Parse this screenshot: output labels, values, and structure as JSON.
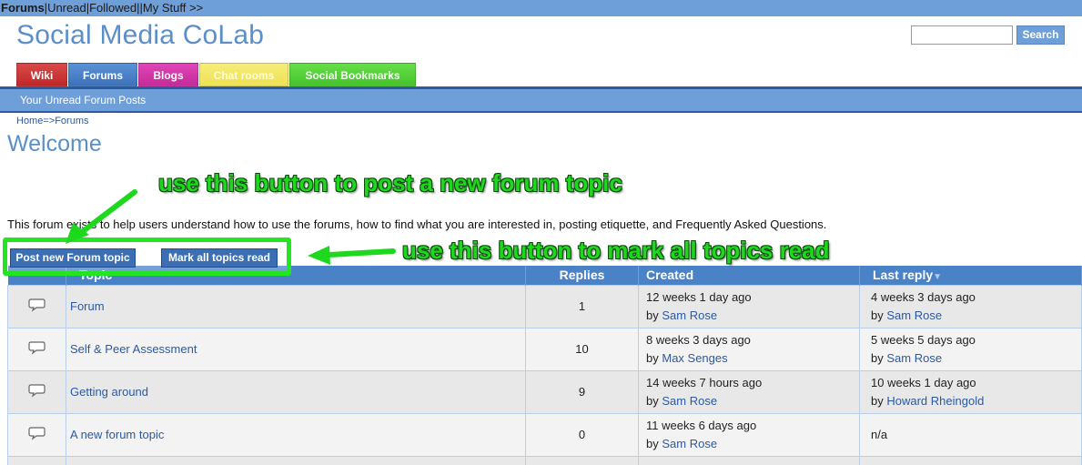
{
  "topbar": {
    "forums": "Forums",
    "unread": "Unread",
    "followed": "Followed",
    "my_stuff": "My Stuff >>",
    "sep": "|"
  },
  "site": {
    "title": "Social Media CoLab"
  },
  "search": {
    "value": "",
    "placeholder": "",
    "button_label": "Search"
  },
  "tabs": [
    {
      "label": "Wiki"
    },
    {
      "label": "Forums"
    },
    {
      "label": "Blogs"
    },
    {
      "label": "Chat rooms"
    },
    {
      "label": "Social Bookmarks"
    }
  ],
  "subnav": {
    "label": "Your Unread Forum Posts"
  },
  "breadcrumb": {
    "home": "Home",
    "separator": "=>",
    "forums": "Forums"
  },
  "page": {
    "title": "Welcome",
    "description": "This forum exists to help users understand how to use the forums, how to find what you are interested in, posting etiquette, and Frequently Asked Questions."
  },
  "annotations": {
    "post_hint": "use this button to post a new forum topic",
    "mark_hint": "use this button to mark all topics read"
  },
  "actions": {
    "post_label": "Post new Forum topic",
    "mark_label": "Mark all topics read"
  },
  "table": {
    "headers": {
      "topic": "Topic",
      "replies": "Replies",
      "created": "Created",
      "last_reply": "Last reply"
    },
    "rows": [
      {
        "topic": "Forum",
        "replies": "1",
        "created_time": "12 weeks 1 day ago",
        "created_by_prefix": "by",
        "created_by": "Sam Rose",
        "last_time": "4 weeks 3 days ago",
        "last_by_prefix": "by",
        "last_by": "Sam Rose"
      },
      {
        "topic": "Self & Peer Assessment",
        "replies": "10",
        "created_time": "8 weeks 3 days ago",
        "created_by_prefix": "by",
        "created_by": "Max Senges",
        "last_time": "5 weeks 5 days ago",
        "last_by_prefix": "by",
        "last_by": "Sam Rose"
      },
      {
        "topic": "Getting around",
        "replies": "9",
        "created_time": "14 weeks 7 hours ago",
        "created_by_prefix": "by",
        "created_by": "Sam Rose",
        "last_time": "10 weeks 1 day ago",
        "last_by_prefix": "by",
        "last_by": "Howard Rheingold"
      },
      {
        "topic": "A new forum topic",
        "replies": "0",
        "created_time": "11 weeks 6 days ago",
        "created_by_prefix": "by",
        "created_by": "Sam Rose",
        "last_time": "n/a"
      }
    ]
  },
  "icons": {
    "topic_icon": "speech-bubble-icon",
    "sort_icon": "sort-down-icon",
    "arrow_icon": "green-arrow-icon"
  },
  "colors": {
    "accent": "#6f9fd8",
    "table_header": "#4a82c8",
    "annotation": "#1ed81e",
    "link": "#2c5aa0"
  }
}
